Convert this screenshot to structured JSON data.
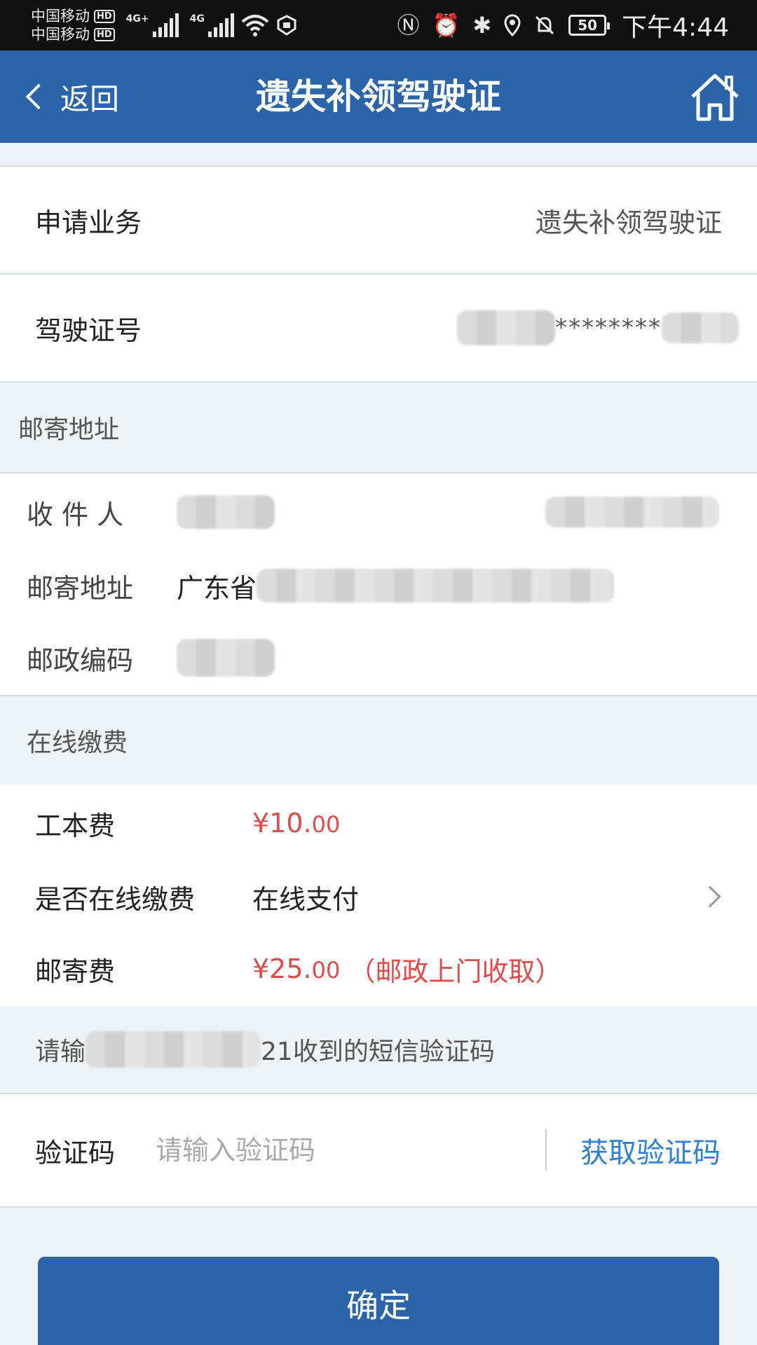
{
  "status_bar": {
    "carrier1": "中国移动",
    "carrier2": "中国移动",
    "hd": "HD",
    "net1": "4G+",
    "net2": "4G",
    "battery": "50",
    "time": "下午4:44"
  },
  "header": {
    "back_label": "返回",
    "title": "遗失补领驾驶证"
  },
  "business": {
    "label": "申请业务",
    "value": "遗失补领驾驶证"
  },
  "license": {
    "label": "驾驶证号",
    "value_masked": "********"
  },
  "mail_section": {
    "title": "邮寄地址",
    "recipient_label": "收 件 人",
    "address_label": "邮寄地址",
    "address_prefix": "广东省",
    "postcode_label": "邮政编码"
  },
  "payment_section": {
    "title": "在线缴费",
    "fee_label": "工本费",
    "fee_main": "¥10.",
    "fee_cents": "00",
    "online_label": "是否在线缴费",
    "online_value": "在线支付",
    "postage_label": "邮寄费",
    "postage_main": "¥25.",
    "postage_cents": "00",
    "postage_note": "（邮政上门收取）"
  },
  "sms": {
    "hint_prefix": "请输",
    "hint_suffix": "21收到的短信验证码",
    "code_label": "验证码",
    "code_placeholder": "请输入验证码",
    "get_code": "获取验证码"
  },
  "confirm_label": "确定",
  "colors": {
    "primary": "#2b64a8",
    "price_red": "#e04b4b",
    "link_blue": "#2f7fd6"
  }
}
